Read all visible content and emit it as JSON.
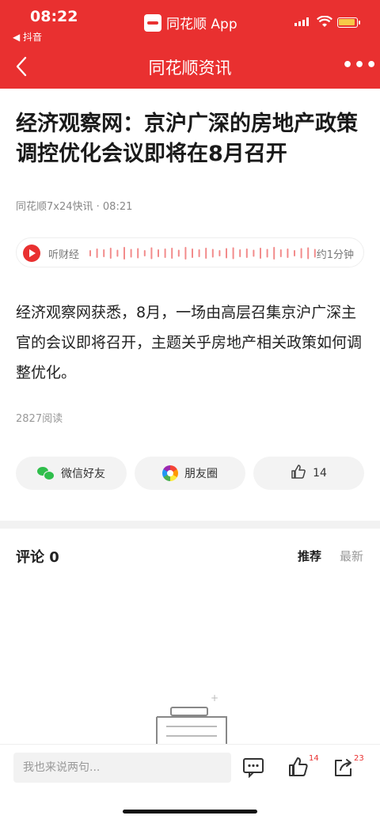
{
  "status_bar": {
    "time": "08:22",
    "back_app": "◀ 抖音",
    "app_name": "同花顺 App"
  },
  "nav": {
    "title": "同花顺资讯",
    "more": "•••"
  },
  "article": {
    "headline": "经济观察网：京沪广深的房地产政策调控优化会议即将在8月召开",
    "meta": "同花顺7x24快讯 · 08:21",
    "audio_label": "听财经",
    "audio_duration": "约1分钟",
    "body": "经济观察网获悉，8月，一场由高层召集京沪广深主官的会议即将召开，主题关乎房地产相关政策如何调整优化。",
    "reads": "2827阅读"
  },
  "share": {
    "wechat": "微信好友",
    "moments": "朋友圈",
    "likes": "14"
  },
  "comments": {
    "title": "评论 0",
    "sort_hot": "推荐",
    "sort_new": "最新"
  },
  "bottom_bar": {
    "placeholder": "我也来说两句...",
    "like_count": "14",
    "share_count": "23"
  },
  "colors": {
    "brand_red": "#e93030"
  }
}
